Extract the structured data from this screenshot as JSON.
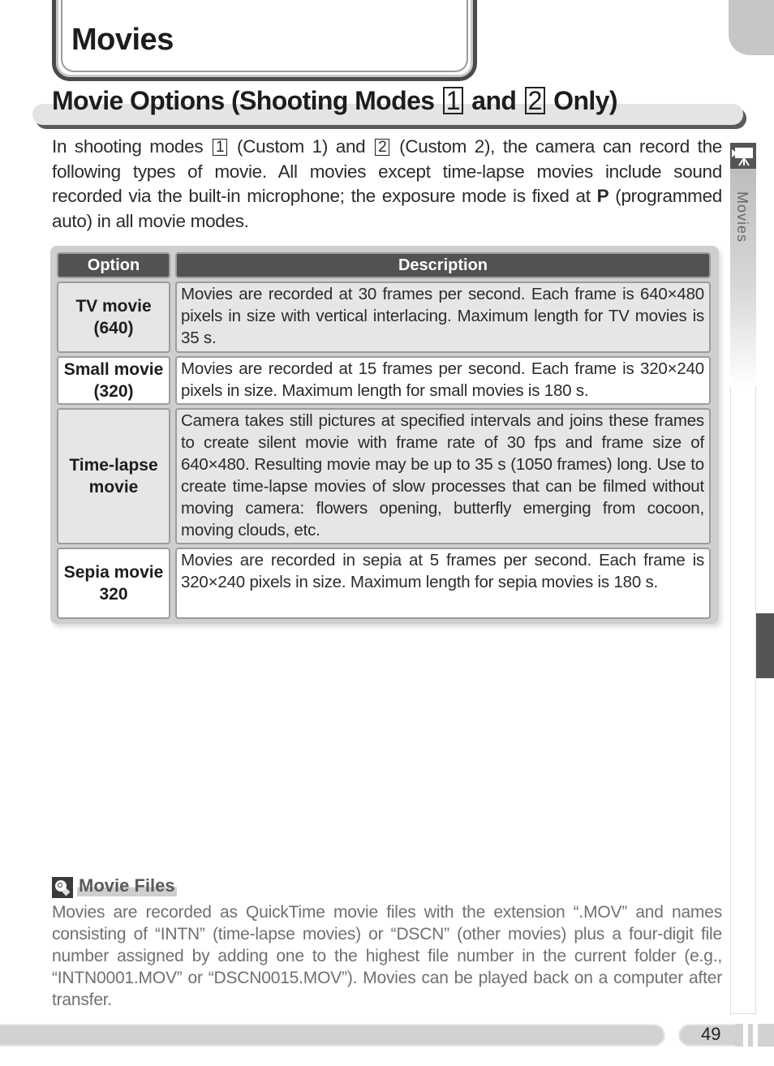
{
  "chapter": {
    "title": "Movies"
  },
  "section": {
    "title_part1": "Movie Options (Shooting Modes",
    "mode1": "1",
    "title_and": "and",
    "mode2": "2",
    "title_part2": "Only)"
  },
  "intro": {
    "t1": "In shooting modes",
    "mode1": "1",
    "t2": "(Custom 1) and",
    "mode2": "2",
    "t3": "(Custom 2), the camera can record the following types of movie.  All movies except time-lapse movies include sound recorded via the built-in microphone; the exposure mode is fixed at",
    "bold": "P",
    "t4": "(programmed auto) in all movie modes."
  },
  "side_tab": {
    "label": "Movies",
    "icon": "movie-camera-icon"
  },
  "table": {
    "headers": [
      "Option",
      "Description"
    ],
    "rows": [
      {
        "option_line1": "TV movie",
        "option_line2": "(640)",
        "description": "Movies are recorded at 30 frames per second.  Each frame is 640×480 pixels in size with vertical interlacing.  Maximum length for TV movies is 35 s."
      },
      {
        "option_line1": "Small movie",
        "option_line2": "(320)",
        "description": "Movies are recorded at 15 frames per second.  Each frame is 320×240 pixels in size.  Maximum length for small movies is 180 s."
      },
      {
        "option_line1": "Time-lapse",
        "option_line2": "movie",
        "description": "Camera takes still pictures at specified intervals and joins these frames to create silent movie with frame rate of 30 fps and frame size of 640×480.  Resulting movie may be up to 35 s (1050 frames) long.  Use to create time-lapse movies of slow processes that can be filmed without moving camera: flowers opening, butterfly emerging from cocoon, moving clouds, etc."
      },
      {
        "option_line1": "Sepia movie",
        "option_line2": "320",
        "description": "Movies are recorded in sepia at 5 frames per second.  Each frame is 320×240 pixels in size.    Maximum length for sepia movies is 180 s."
      }
    ]
  },
  "note": {
    "icon": "tip-icon",
    "title": "Movie Files",
    "body": "Movies are recorded as QuickTime movie files with the extension “.MOV” and names consisting of “INTN” (time-lapse movies) or “DSCN” (other movies) plus a four-digit file number assigned by adding one to the highest file number in the current folder (e.g., “INTN0001.MOV” or “DSCN0015.MOV”).  Movies can be played back on a computer after transfer."
  },
  "footer": {
    "page_number": "49"
  }
}
